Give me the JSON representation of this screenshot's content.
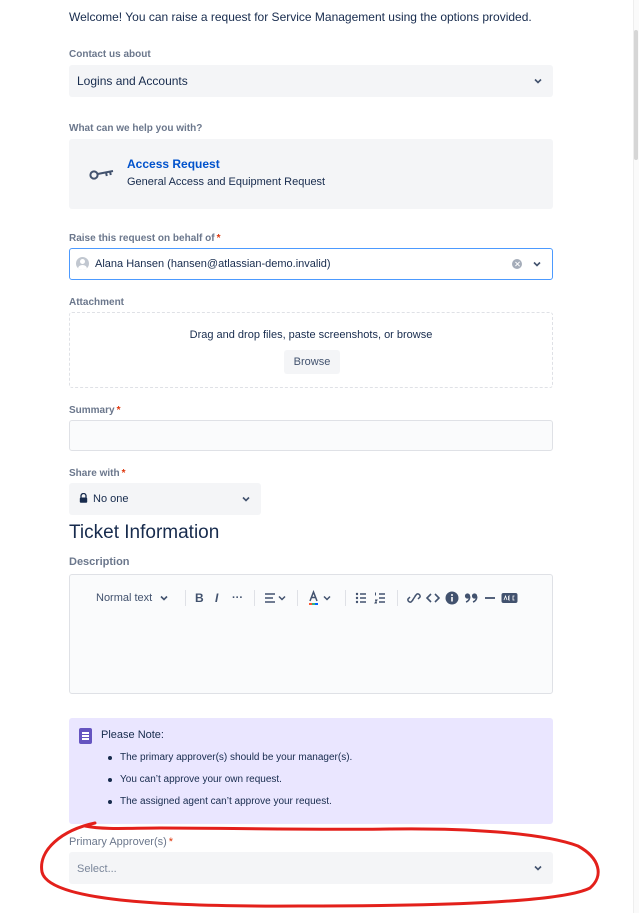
{
  "welcome_text": "Welcome! You can raise a request for Service Management using the options provided.",
  "contact": {
    "label": "Contact us about",
    "value": "Logins and Accounts"
  },
  "help": {
    "label": "What can we help you with?",
    "request_title": "Access Request",
    "request_desc": "General Access and Equipment Request",
    "icon": "key-icon"
  },
  "behalf": {
    "label": "Raise this request on behalf of",
    "required": "*",
    "value": "Alana Hansen (hansen@atlassian-demo.invalid)"
  },
  "attachment": {
    "label": "Attachment",
    "drop_text": "Drag and drop files, paste screenshots, or browse",
    "browse_label": "Browse"
  },
  "summary": {
    "label": "Summary",
    "required": "*",
    "value": ""
  },
  "share": {
    "label": "Share with",
    "required": "*",
    "value": "No one"
  },
  "section_heading": "Ticket Information",
  "description": {
    "label": "Description",
    "toolbar": {
      "text_style": "Normal text",
      "bold": "B",
      "italic": "I",
      "more": "···"
    }
  },
  "note": {
    "title": "Please Note:",
    "items": [
      "The primary approver(s) should be your manager(s).",
      "You can’t approve your own request.",
      "The assigned agent can’t approve your request."
    ]
  },
  "approver": {
    "label": "Primary Approver(s)",
    "required": "*",
    "placeholder": "Select..."
  },
  "colors": {
    "accent": "#0052cc",
    "annotation": "#e3201b",
    "note_bg": "#eae6ff",
    "required": "#de350b"
  }
}
